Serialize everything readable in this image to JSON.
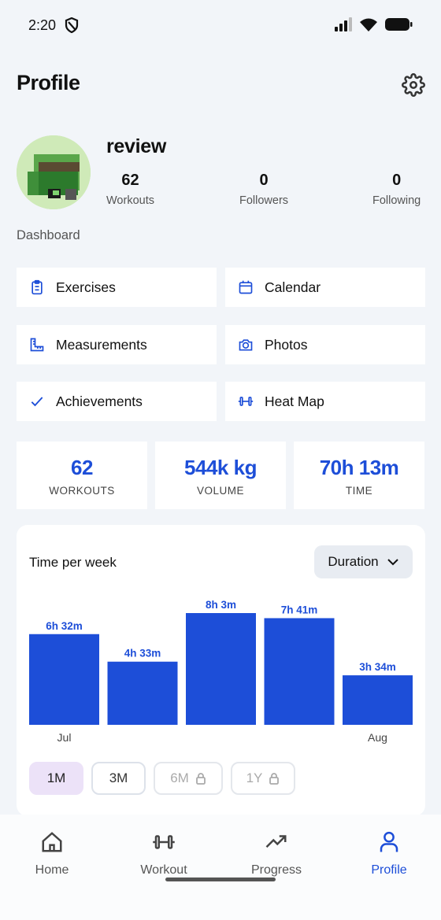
{
  "status": {
    "time": "2:20"
  },
  "header": {
    "title": "Profile"
  },
  "profile": {
    "username": "review",
    "stats": [
      {
        "value": "62",
        "label": "Workouts"
      },
      {
        "value": "0",
        "label": "Followers"
      },
      {
        "value": "0",
        "label": "Following"
      }
    ]
  },
  "dashboard": {
    "label": "Dashboard",
    "tiles": [
      {
        "label": "Exercises",
        "icon": "clipboard-list-icon"
      },
      {
        "label": "Calendar",
        "icon": "calendar-icon"
      },
      {
        "label": "Measurements",
        "icon": "ruler-icon"
      },
      {
        "label": "Photos",
        "icon": "camera-icon"
      },
      {
        "label": "Achievements",
        "icon": "check-icon"
      },
      {
        "label": "Heat Map",
        "icon": "dumbbell-icon"
      }
    ]
  },
  "metrics": [
    {
      "value": "62",
      "caption": "WORKOUTS"
    },
    {
      "value": "544k kg",
      "caption": "VOLUME"
    },
    {
      "value": "70h 13m",
      "caption": "TIME"
    }
  ],
  "chart": {
    "title": "Time per week",
    "dropdown_label": "Duration",
    "ranges": [
      {
        "label": "1M",
        "active": true,
        "locked": false
      },
      {
        "label": "3M",
        "active": false,
        "locked": false
      },
      {
        "label": "6M",
        "active": false,
        "locked": true
      },
      {
        "label": "1Y",
        "active": false,
        "locked": true
      }
    ]
  },
  "chart_data": {
    "type": "bar",
    "title": "Time per week",
    "categories": [
      "Jul",
      "",
      "",
      "",
      "Aug"
    ],
    "values": [
      392,
      273,
      483,
      461,
      214
    ],
    "value_unit": "minutes",
    "data_labels": [
      "6h 32m",
      "4h 33m",
      "8h 3m",
      "7h 41m",
      "3h 34m"
    ],
    "color": "#1d4ed8",
    "ylim": [
      0,
      483
    ]
  },
  "nav": {
    "items": [
      {
        "label": "Home",
        "active": false
      },
      {
        "label": "Workout",
        "active": false
      },
      {
        "label": "Progress",
        "active": false
      },
      {
        "label": "Profile",
        "active": true
      }
    ]
  },
  "colors": {
    "accent": "#1d4ed8",
    "background": "#f2f5f9",
    "active_range": "#ece2f8"
  }
}
